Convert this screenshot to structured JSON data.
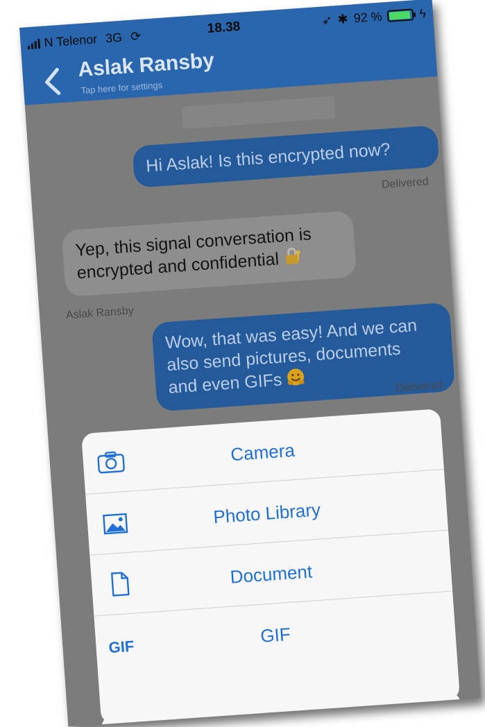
{
  "status_bar": {
    "carrier": "N Telenor",
    "network": "3G",
    "sync_icon": "sync-icon",
    "time": "18.38",
    "battery_percent": "92 %",
    "battery_level": 0.92
  },
  "header": {
    "title": "Aslak Ransby",
    "subtitle": "Tap here for settings",
    "background": "#2a66ad"
  },
  "messages": [
    {
      "direction": "outgoing",
      "text": "Hi Aslak! Is this encrypted now?",
      "status": "Delivered"
    },
    {
      "direction": "incoming",
      "text_line1": "Yep, this signal conversation is",
      "text_line2": "encrypted and confidential",
      "emoji": "lock-with-key",
      "sender": "Aslak Ransby"
    },
    {
      "direction": "outgoing",
      "text_line1": "Wow, that was easy! And we can",
      "text_line2": "also send pictures, documents",
      "text_line3": "and even GIFs",
      "emoji": "hugging-face",
      "status": "Delivered"
    }
  ],
  "action_sheet": {
    "items": [
      {
        "label": "Camera",
        "icon": "camera-icon"
      },
      {
        "label": "Photo Library",
        "icon": "photo-library-icon"
      },
      {
        "label": "Document",
        "icon": "document-icon"
      },
      {
        "label": "GIF",
        "icon": "gif-icon",
        "icon_text": "GIF"
      }
    ],
    "accent": "#1f6fd6"
  }
}
